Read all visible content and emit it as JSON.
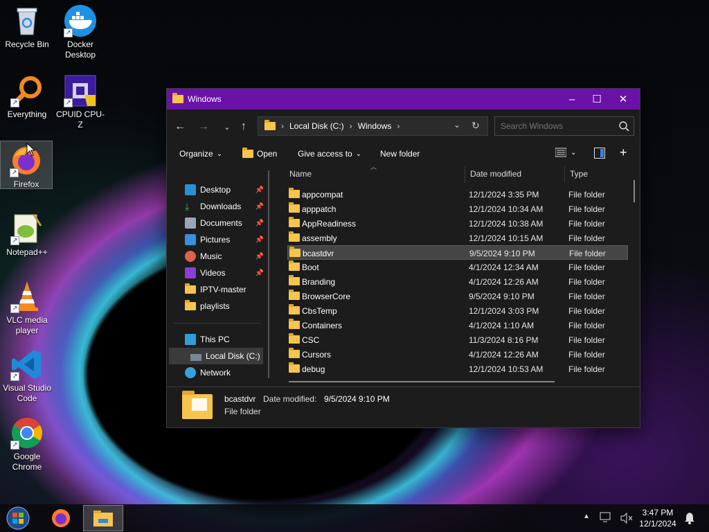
{
  "desktop": {
    "icons": [
      {
        "label": "Recycle Bin"
      },
      {
        "label": "Docker Desktop"
      },
      {
        "label": "Everything"
      },
      {
        "label": "CPUID CPU-Z"
      },
      {
        "label": "Firefox"
      },
      {
        "label": "Notepad++"
      },
      {
        "label": "VLC media player"
      },
      {
        "label": "Visual Studio Code"
      },
      {
        "label": "Google Chrome"
      }
    ]
  },
  "explorer": {
    "title": "Windows",
    "address": {
      "segments": [
        "Local Disk (C:)",
        "Windows"
      ]
    },
    "search": {
      "placeholder": "Search Windows"
    },
    "toolbar": {
      "organize": "Organize",
      "open": "Open",
      "give_access": "Give access to",
      "new_folder": "New folder"
    },
    "nav": {
      "quick_access": [
        {
          "label": "Desktop",
          "pinned": true
        },
        {
          "label": "Downloads",
          "pinned": true
        },
        {
          "label": "Documents",
          "pinned": true
        },
        {
          "label": "Pictures",
          "pinned": true
        },
        {
          "label": "Music",
          "pinned": true
        },
        {
          "label": "Videos",
          "pinned": true
        },
        {
          "label": "IPTV-master",
          "pinned": false
        },
        {
          "label": "playlists",
          "pinned": false
        }
      ],
      "this_pc": "This PC",
      "local_disk": "Local Disk (C:)",
      "network": "Network"
    },
    "columns": {
      "name": "Name",
      "date": "Date modified",
      "type": "Type"
    },
    "files": [
      {
        "name": "appcompat",
        "date": "12/1/2024 3:35 PM",
        "type": "File folder"
      },
      {
        "name": "apppatch",
        "date": "12/1/2024 10:34 AM",
        "type": "File folder"
      },
      {
        "name": "AppReadiness",
        "date": "12/1/2024 10:38 AM",
        "type": "File folder"
      },
      {
        "name": "assembly",
        "date": "12/1/2024 10:15 AM",
        "type": "File folder"
      },
      {
        "name": "bcastdvr",
        "date": "9/5/2024 9:10 PM",
        "type": "File folder",
        "selected": true
      },
      {
        "name": "Boot",
        "date": "4/1/2024 12:34 AM",
        "type": "File folder"
      },
      {
        "name": "Branding",
        "date": "4/1/2024 12:26 AM",
        "type": "File folder"
      },
      {
        "name": "BrowserCore",
        "date": "9/5/2024 9:10 PM",
        "type": "File folder"
      },
      {
        "name": "CbsTemp",
        "date": "12/1/2024 3:03 PM",
        "type": "File folder"
      },
      {
        "name": "Containers",
        "date": "4/1/2024 1:10 AM",
        "type": "File folder"
      },
      {
        "name": "CSC",
        "date": "11/3/2024 8:16 PM",
        "type": "File folder"
      },
      {
        "name": "Cursors",
        "date": "4/1/2024 12:26 AM",
        "type": "File folder"
      },
      {
        "name": "debug",
        "date": "12/1/2024 10:53 AM",
        "type": "File folder"
      }
    ],
    "details": {
      "name": "bcastdvr",
      "date_label": "Date modified:",
      "date_value": "9/5/2024 9:10 PM",
      "type": "File folder"
    }
  },
  "taskbar": {
    "time": "3:47 PM",
    "date": "12/1/2024"
  },
  "colors": {
    "titlebar": "#6a12a8",
    "window_bg": "#1c1c1c",
    "folder": "#f6c54d"
  }
}
